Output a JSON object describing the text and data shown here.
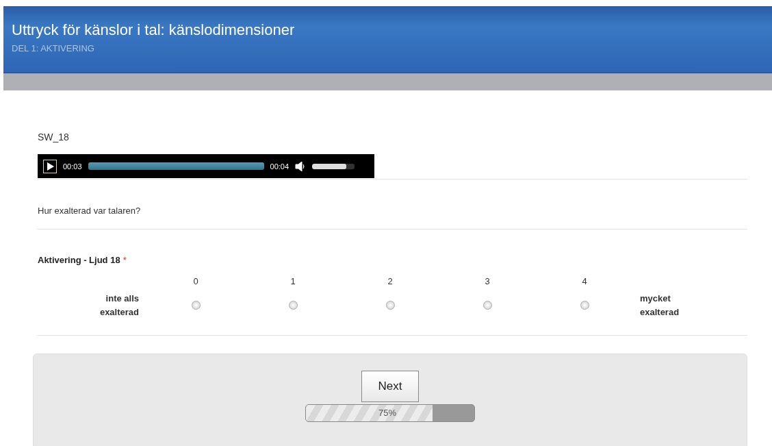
{
  "header": {
    "title": "Uttryck för känslor i tal: känslodimensioner",
    "subtitle": "DEL 1: AKTIVERING"
  },
  "audio": {
    "label": "SW_18",
    "elapsed": "00:03",
    "duration": "00:04",
    "level": 1,
    "volume": {
      "level": 0.8
    }
  },
  "question": "Hur exalterad var talaren?",
  "rating": {
    "title": "Aktivering - Ljud 18",
    "required": true,
    "required_mark": "*",
    "low_label": "inte alls exalterad",
    "high_label": "mycket exalterad",
    "options": [
      {
        "label": "0",
        "selected": false
      },
      {
        "label": "1",
        "selected": false
      },
      {
        "label": "2",
        "selected": false
      },
      {
        "label": "3",
        "selected": false
      },
      {
        "label": "4",
        "selected": false
      }
    ]
  },
  "footer": {
    "button": "Next",
    "progress": {
      "level": 0.75,
      "reading": "75%"
    }
  }
}
